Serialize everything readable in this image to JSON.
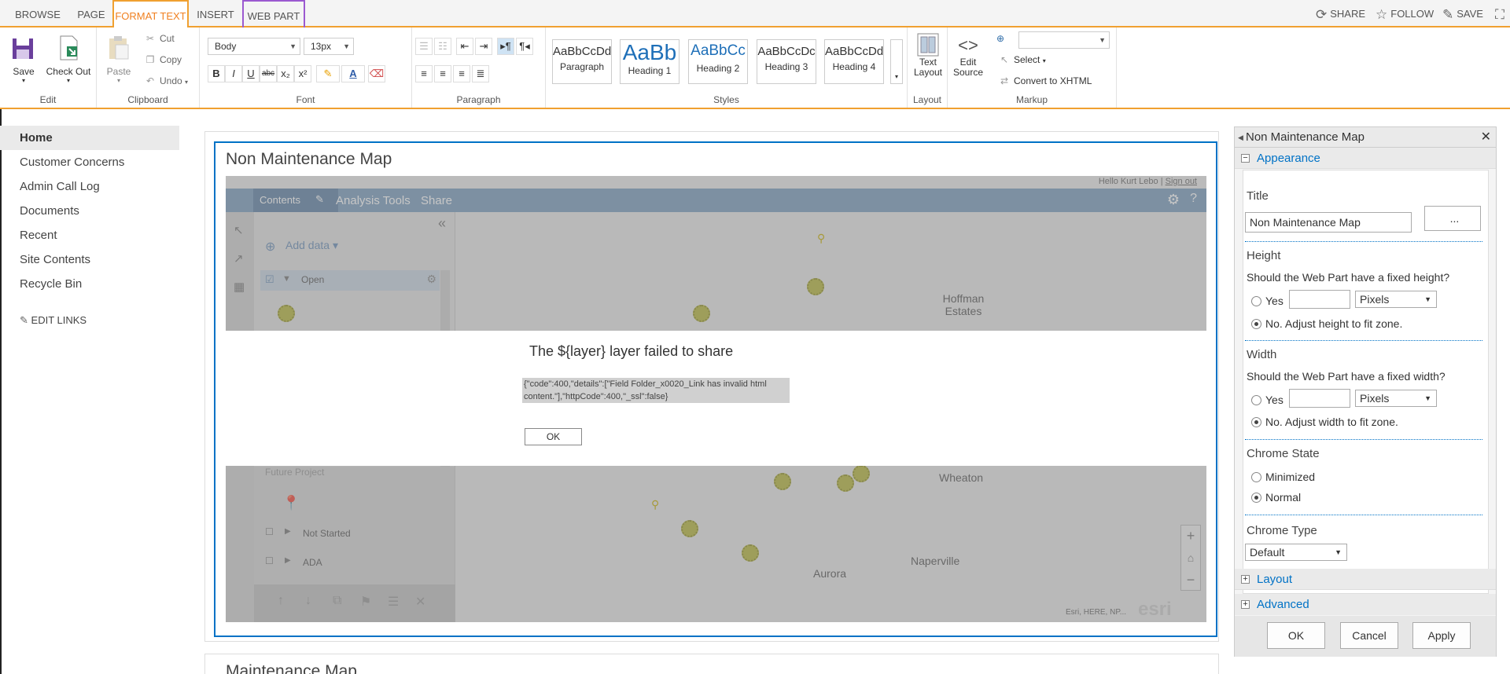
{
  "tabs": {
    "browse": "BROWSE",
    "page": "PAGE",
    "format_text": "FORMAT TEXT",
    "insert": "INSERT",
    "web_part": "WEB PART"
  },
  "top_actions": {
    "share": "SHARE",
    "follow": "FOLLOW",
    "save": "SAVE"
  },
  "ribbon": {
    "edit": {
      "save": "Save",
      "check_out": "Check Out",
      "label": "Edit"
    },
    "clipboard": {
      "paste": "Paste",
      "cut": "Cut",
      "copy": "Copy",
      "undo": "Undo",
      "label": "Clipboard"
    },
    "font": {
      "family": "Body",
      "size": "13px",
      "label": "Font"
    },
    "paragraph": {
      "label": "Paragraph"
    },
    "styles": {
      "label": "Styles",
      "items": [
        {
          "sample": "AaBbCcDdI",
          "name": "Paragraph"
        },
        {
          "sample": "AaBb",
          "name": "Heading 1"
        },
        {
          "sample": "AaBbCc",
          "name": "Heading 2"
        },
        {
          "sample": "AaBbCcDc",
          "name": "Heading 3"
        },
        {
          "sample": "AaBbCcDdI",
          "name": "Heading 4"
        }
      ]
    },
    "layout": {
      "text_layout": "Text Layout",
      "label": "Layout"
    },
    "markup": {
      "edit_source": "Edit Source",
      "select": "Select",
      "convert": "Convert to XHTML",
      "label": "Markup"
    }
  },
  "leftnav": {
    "items": [
      "Home",
      "Customer Concerns",
      "Admin Call Log",
      "Documents",
      "Recent",
      "Site Contents",
      "Recycle Bin"
    ],
    "edit_links": "EDIT LINKS"
  },
  "webpart": {
    "title": "Non Maintenance Map",
    "map": {
      "greeting": "Hello Kurt Lebo |",
      "sign_out": "Sign out",
      "tabs": [
        "Contents",
        "Analysis Tools",
        "Share"
      ],
      "add_data": "Add data",
      "layers": [
        "Open",
        "Future Project",
        "Not Started",
        "ADA"
      ],
      "places": [
        "Hoffman Estates",
        "Wheaton",
        "Naperville",
        "Aurora"
      ],
      "attribution": "Esri, HERE, NP...",
      "logo": "esri"
    },
    "dialog": {
      "title": "The ${layer} layer failed to share",
      "message": "{\"code\":400,\"details\":[\"Field Folder_x0020_Link has invalid html content.\"],\"httpCode\":400,\"_ssl\":false}",
      "ok": "OK"
    }
  },
  "next_webpart": {
    "title": "Maintenance Map"
  },
  "toolpane": {
    "header": "Non Maintenance Map",
    "sections": {
      "appearance": "Appearance",
      "layout": "Layout",
      "advanced": "Advanced"
    },
    "title_label": "Title",
    "title_value": "Non Maintenance Map",
    "builder_button": "...",
    "height": {
      "label": "Height",
      "question": "Should the Web Part have a fixed height?",
      "yes": "Yes",
      "unit": "Pixels",
      "no": "No. Adjust height to fit zone."
    },
    "width": {
      "label": "Width",
      "question": "Should the Web Part have a fixed width?",
      "yes": "Yes",
      "unit": "Pixels",
      "no": "No. Adjust width to fit zone."
    },
    "chrome_state": {
      "label": "Chrome State",
      "minimized": "Minimized",
      "normal": "Normal"
    },
    "chrome_type": {
      "label": "Chrome Type",
      "value": "Default"
    },
    "buttons": {
      "ok": "OK",
      "cancel": "Cancel",
      "apply": "Apply"
    }
  }
}
